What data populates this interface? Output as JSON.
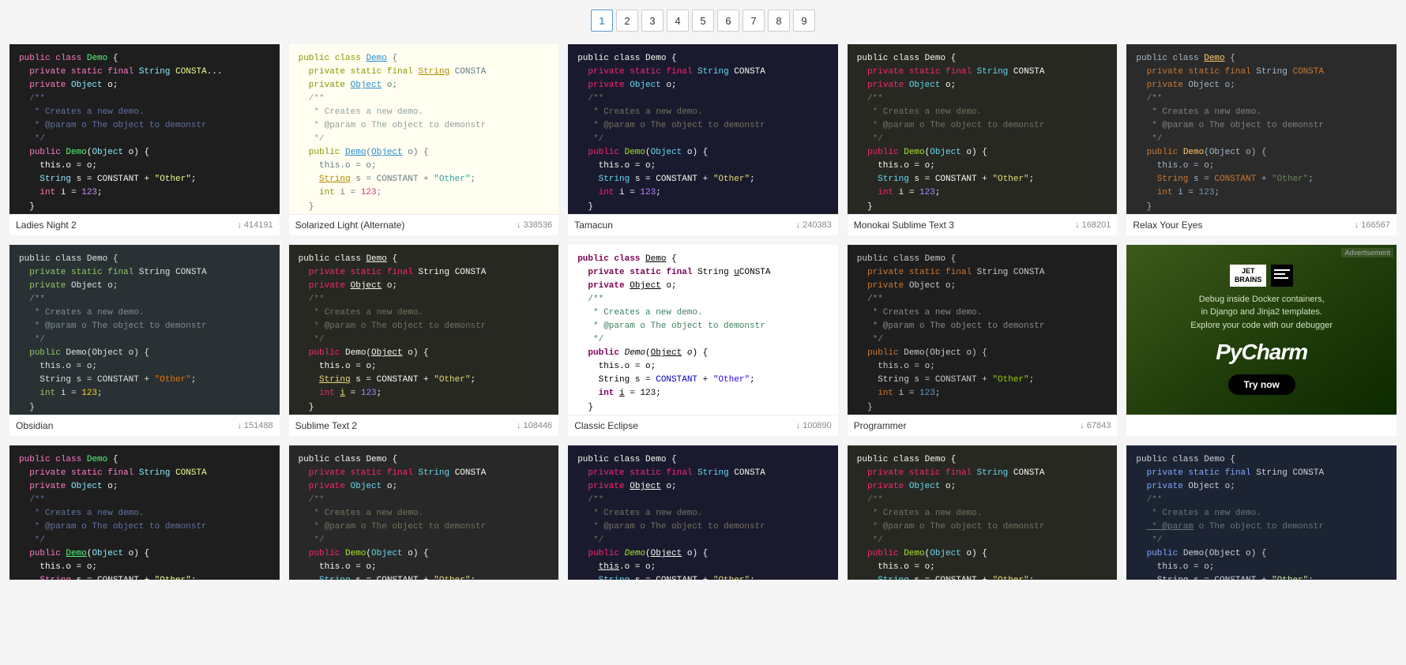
{
  "pagination": {
    "pages": [
      "1",
      "2",
      "3",
      "4",
      "5",
      "6",
      "7",
      "8",
      "9"
    ],
    "active": "1"
  },
  "themes": [
    {
      "id": "ladies-night-2",
      "name": "Ladies Night 2",
      "downloads": "414191",
      "bg": "#1e1e1e",
      "scheme": "ladies-night"
    },
    {
      "id": "solarized-light",
      "name": "Solarized Light (Alternate)",
      "downloads": "338536",
      "bg": "#fffef0",
      "scheme": "solarized"
    },
    {
      "id": "tamacun",
      "name": "Tamacun",
      "downloads": "240383",
      "bg": "#1a1a2e",
      "scheme": "tamacun"
    },
    {
      "id": "monokai-sublime",
      "name": "Monokai Sublime Text 3",
      "downloads": "168201",
      "bg": "#272822",
      "scheme": "monokai"
    },
    {
      "id": "relax-your-eyes",
      "name": "Relax Your Eyes",
      "downloads": "166567",
      "bg": "#1c2333",
      "scheme": "relax"
    },
    {
      "id": "obsidian",
      "name": "Obsidian",
      "downloads": "151488",
      "bg": "#293134",
      "scheme": "obsidian"
    },
    {
      "id": "sublime-text-2",
      "name": "Sublime Text 2",
      "downloads": "108446",
      "bg": "#272822",
      "scheme": "sublime2"
    },
    {
      "id": "classic-eclipse",
      "name": "Classic Eclipse",
      "downloads": "100890",
      "bg": "#ffffff",
      "scheme": "eclipse"
    },
    {
      "id": "programmer",
      "name": "Programmer",
      "downloads": "67843",
      "bg": "#1e1e1e",
      "scheme": "programmer"
    },
    {
      "id": "ad-jetbrains",
      "name": "Advertisement",
      "downloads": "",
      "bg": "",
      "scheme": "ad"
    },
    {
      "id": "row3-1",
      "name": "",
      "downloads": "",
      "bg": "#1e1e1e",
      "scheme": "ladies-night"
    },
    {
      "id": "row3-2",
      "name": "",
      "downloads": "",
      "bg": "#282828",
      "scheme": "tamacun"
    },
    {
      "id": "row3-3",
      "name": "",
      "downloads": "",
      "bg": "#1a1a2e",
      "scheme": "tamacun"
    },
    {
      "id": "row3-4",
      "name": "",
      "downloads": "",
      "bg": "#272822",
      "scheme": "monokai"
    },
    {
      "id": "row3-5",
      "name": "",
      "downloads": "",
      "bg": "#1c2333",
      "scheme": "obsidian"
    }
  ],
  "ad": {
    "jetbrains_label": "JET\nBRAINS",
    "headline": "Debug inside Docker containers,\nin Django and Jinja2 templates.\nExplore your code with our debugger",
    "product": "PyCharm",
    "cta": "Try now",
    "badge": "Advertisement"
  },
  "download_icon": "↓"
}
